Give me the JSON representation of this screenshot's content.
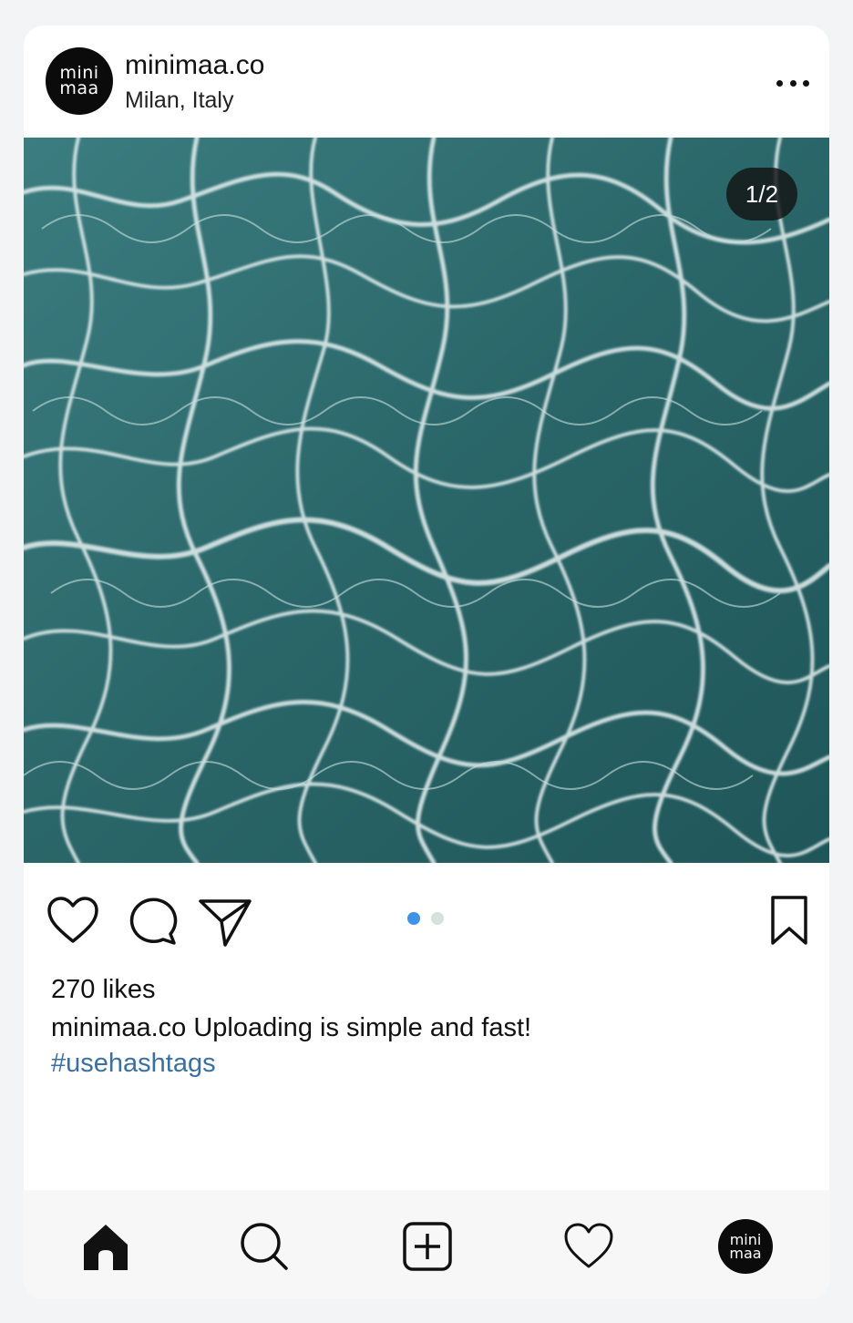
{
  "post": {
    "username": "minimaa.co",
    "location": "Milan, Italy",
    "avatar_text_line1": "mini",
    "avatar_text_line2": "maa",
    "more_icon": "more-horizontal-icon",
    "image_counter": "1/2",
    "image_description_icon": "pool-water-photo",
    "likes": "270 likes",
    "caption_user": "minimaa.co",
    "caption_text": "Uploading is simple and fast!",
    "hashtag": "#usehashtags",
    "carousel": {
      "total": 2,
      "active": 1,
      "active_color": "#3e93e8",
      "inactive_color": "#d5e3dc"
    }
  },
  "actions": {
    "like_icon": "heart-icon",
    "comment_icon": "comment-icon",
    "share_icon": "send-icon",
    "save_icon": "bookmark-icon"
  },
  "bottom_nav": {
    "home_icon": "home-icon",
    "search_icon": "search-icon",
    "add_icon": "add-post-icon",
    "activity_icon": "heart-icon",
    "profile_avatar_line1": "mini",
    "profile_avatar_line2": "maa"
  },
  "colors": {
    "page_bg": "#f3f4f6",
    "card_bg": "#ffffff",
    "hashtag": "#3b6fa0",
    "water": "#2c6a6e"
  }
}
